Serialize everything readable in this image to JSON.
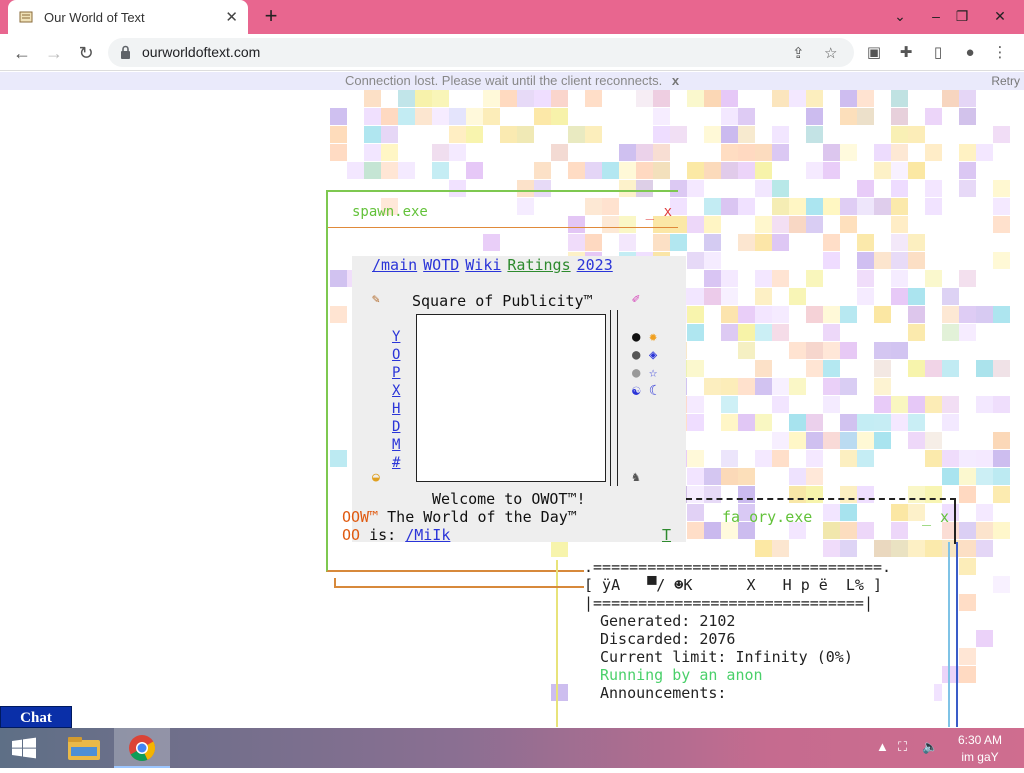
{
  "browser": {
    "tab_title": "Our World of Text",
    "url": "ourworldoftext.com"
  },
  "banner": {
    "message": "Connection lost. Please wait until the client reconnects.",
    "close": "x",
    "retry": "Retry"
  },
  "spawn_window": {
    "title": "spawn.exe",
    "minimize": "_",
    "close": "x",
    "menu": [
      "/main",
      "WOTD",
      "Wiki",
      "Ratings",
      "2023"
    ],
    "square_title": "Square of Publicity™",
    "letters": [
      "Y",
      "O",
      "P",
      "X",
      "H",
      "D",
      "M",
      "#"
    ],
    "welcome": "Welcome to OWOT™!",
    "wotd_line1": "The World of the Day™",
    "wotd_is": "is:",
    "wotd_link": "/MiIk",
    "prefix1": "OOW™",
    "prefix2": "OO",
    "marker": "T"
  },
  "factory_window": {
    "title": "fa  ory.exe",
    "controls": "_ x",
    "divider": ".================================.",
    "glitch_line": "[ ÿA   ▀/ ☻K      X   H p ë  L% ]",
    "divider2": "|==============================|",
    "generated": "Generated: 2102",
    "discarded": "Discarded: 2076",
    "limit": "Current limit: Infinity (0%)",
    "running": "Running by an anon",
    "announcements": "Announcements:"
  },
  "chat": {
    "label": "Chat"
  },
  "taskbar": {
    "time": "6:30 AM",
    "date": "im gaY"
  }
}
